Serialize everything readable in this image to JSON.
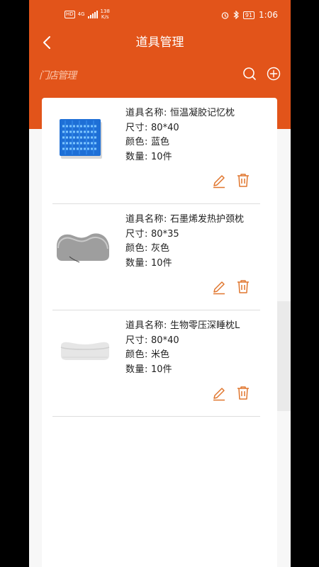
{
  "status_bar": {
    "network": "4G",
    "hd": "HD",
    "speed_value": "138",
    "speed_unit": "K/s",
    "battery": "91",
    "time": "1:06"
  },
  "header": {
    "title": "道具管理",
    "store_label": "门店管理"
  },
  "items": [
    {
      "name_label": "道具名称:",
      "name": "恒温凝胶记忆枕",
      "size_label": "尺寸:",
      "size": "80*40",
      "color_label": "颜色:",
      "color": "蓝色",
      "qty_label": "数量:",
      "qty": "10件"
    },
    {
      "name_label": "道具名称:",
      "name": "石墨烯发热护颈枕",
      "size_label": "尺寸:",
      "size": "80*35",
      "color_label": "颜色:",
      "color": "灰色",
      "qty_label": "数量:",
      "qty": "10件"
    },
    {
      "name_label": "道具名称:",
      "name": "生物零压深睡枕L",
      "size_label": "尺寸:",
      "size": "80*40",
      "color_label": "颜色:",
      "color": "米色",
      "qty_label": "数量:",
      "qty": "10件"
    }
  ],
  "colors": {
    "accent": "#e2541a",
    "icon": "#e0762e"
  }
}
